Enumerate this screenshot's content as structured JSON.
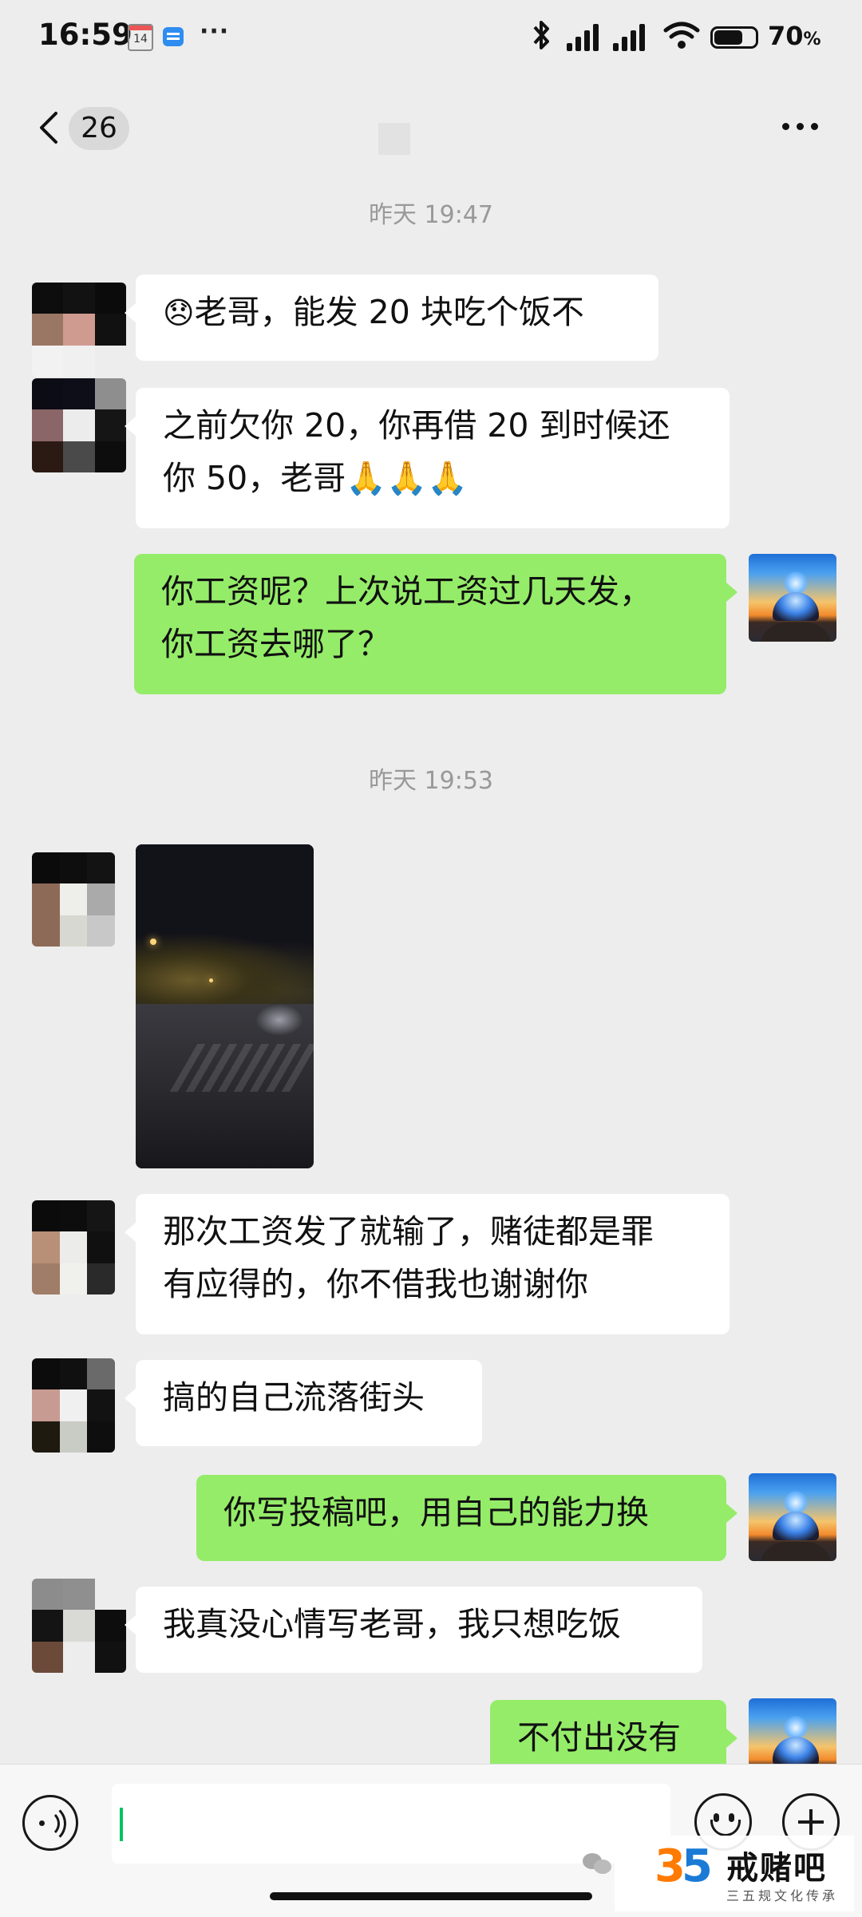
{
  "status_bar": {
    "time": "16:59",
    "calendar_day": "14",
    "battery_percent": "70",
    "battery_unit": "%",
    "battery_level": 0.7
  },
  "header": {
    "unread_count": "26"
  },
  "messages": {
    "ts1": "昨天 19:47",
    "m1_emoji": "😞",
    "m1_text": "老哥，能发 20 块吃个饭不",
    "m2_line1": "之前欠你 20，你再借 20 到时候还",
    "m2_line2": "你 50，老哥🙏🙏🙏",
    "m3_line1": "你工资呢？上次说工资过几天发，",
    "m3_line2": "你工资去哪了？",
    "ts2": "昨天 19:53",
    "m5_line1": "那次工资发了就输了，赌徒都是罪",
    "m5_line2": "有应得的，你不借我也谢谢你",
    "m6_text": "搞的自己流落街头",
    "m7_text": "你写投稿吧，用自己的能力换",
    "m8_text": "我真没心情写老哥，我只想吃饭",
    "m9_text": "不付出没有"
  },
  "watermark": {
    "logo_digit_1": "3",
    "logo_digit_2": "5",
    "title": "戒赌吧",
    "subtitle": "三五规文化传承"
  },
  "colors": {
    "outgoing_bubble": "#95ec69",
    "incoming_bubble": "#ffffff",
    "background": "#ededed"
  }
}
